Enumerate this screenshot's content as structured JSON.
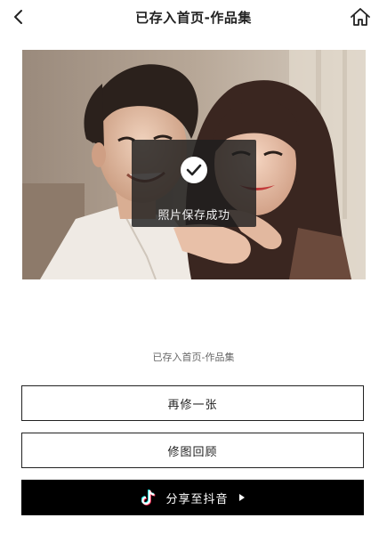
{
  "header": {
    "title": "已存入首页-作品集",
    "back_icon": "chevron-left-icon",
    "home_icon": "home-icon"
  },
  "photo": {
    "description_icon": "couple-photo"
  },
  "toast": {
    "icon": "check-icon",
    "message": "照片保存成功"
  },
  "caption": {
    "text": "已存入首页-作品集"
  },
  "actions": {
    "again_label": "再修一张",
    "retouch_label": "修图回顾",
    "share_label": "分享至抖音",
    "share_icon": "tiktok-icon",
    "share_arrow_icon": "play-arrow-icon"
  },
  "colors": {
    "primary_button_bg": "#000000",
    "primary_button_text": "#ffffff",
    "border": "#222222",
    "toast_bg": "#1e1e1e"
  }
}
